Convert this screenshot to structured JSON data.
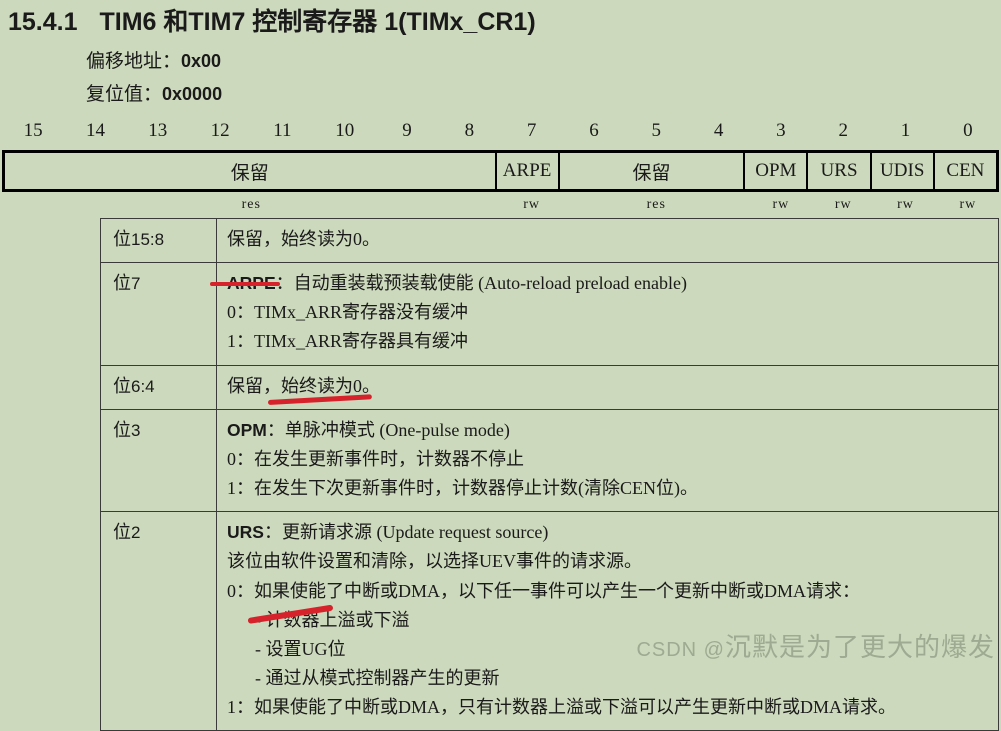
{
  "colors": {
    "page_background": "#ccd9bc",
    "text": "#1a1a1a",
    "annotation_red": "#d6232b",
    "watermark": "#78846e",
    "table_border": "#3a3a3a"
  },
  "title": {
    "section_number": "15.4.1",
    "text": "TIM6 和TIM7 控制寄存器 1(TIMx_CR1)"
  },
  "meta": {
    "offset_label": "偏移地址：",
    "offset_value": "0x00",
    "reset_label": "复位值：",
    "reset_value": "0x0000"
  },
  "register_map": {
    "bit_numbers": [
      "15",
      "14",
      "13",
      "12",
      "11",
      "10",
      "9",
      "8",
      "7",
      "6",
      "5",
      "4",
      "3",
      "2",
      "1",
      "0"
    ],
    "fields": [
      {
        "name": "保留",
        "span": 8,
        "access": "res"
      },
      {
        "name": "ARPE",
        "span": 1,
        "access": "rw"
      },
      {
        "name": "保留",
        "span": 3,
        "access": "res"
      },
      {
        "name": "OPM",
        "span": 1,
        "access": "rw"
      },
      {
        "name": "URS",
        "span": 1,
        "access": "rw"
      },
      {
        "name": "UDIS",
        "span": 1,
        "access": "rw"
      },
      {
        "name": "CEN",
        "span": 1,
        "access": "rw"
      }
    ],
    "access_cells": [
      {
        "label": "res",
        "span": 8
      },
      {
        "label": "rw",
        "span": 1
      },
      {
        "label": "res",
        "span": 3
      },
      {
        "label": "rw",
        "span": 1
      },
      {
        "label": "rw",
        "span": 1
      },
      {
        "label": "rw",
        "span": 1
      },
      {
        "label": "rw",
        "span": 1
      }
    ]
  },
  "bit_descriptions": [
    {
      "bit_label_prefix": "位",
      "bit_label_range": "15:8",
      "lines": [
        {
          "text": "保留，始终读为0。",
          "indent": 0,
          "bold_tag": ""
        }
      ]
    },
    {
      "bit_label_prefix": "位",
      "bit_label_range": "7",
      "lines": [
        {
          "bold_tag": "ARPE",
          "text": "：自动重装载预装载使能 (Auto-reload preload enable)",
          "indent": 0
        },
        {
          "bold_tag": "",
          "text": "0：TIMx_ARR寄存器没有缓冲",
          "indent": 0
        },
        {
          "bold_tag": "",
          "text": "1：TIMx_ARR寄存器具有缓冲",
          "indent": 0
        }
      ]
    },
    {
      "bit_label_prefix": "位",
      "bit_label_range": "6:4",
      "lines": [
        {
          "text": "保留，始终读为0。",
          "indent": 0,
          "bold_tag": ""
        }
      ]
    },
    {
      "bit_label_prefix": "位",
      "bit_label_range": "3",
      "lines": [
        {
          "bold_tag": "OPM",
          "text": "：单脉冲模式 (One-pulse mode)",
          "indent": 0
        },
        {
          "bold_tag": "",
          "text": "0：在发生更新事件时，计数器不停止",
          "indent": 0
        },
        {
          "bold_tag": "",
          "text": "1：在发生下次更新事件时，计数器停止计数(清除CEN位)。",
          "indent": 0
        }
      ]
    },
    {
      "bit_label_prefix": "位",
      "bit_label_range": "2",
      "lines": [
        {
          "bold_tag": "URS",
          "text": "：更新请求源 (Update request source)",
          "indent": 0
        },
        {
          "bold_tag": "",
          "text": "该位由软件设置和清除，以选择UEV事件的请求源。",
          "indent": 0
        },
        {
          "bold_tag": "",
          "text": "0：如果使能了中断或DMA，以下任一事件可以产生一个更新中断或DMA请求：",
          "indent": 0
        },
        {
          "bold_tag": "",
          "text": "- 计数器上溢或下溢",
          "indent": 1
        },
        {
          "bold_tag": "",
          "text": "- 设置UG位",
          "indent": 1
        },
        {
          "bold_tag": "",
          "text": "- 通过从模式控制器产生的更新",
          "indent": 1
        },
        {
          "bold_tag": "",
          "text": "1：如果使能了中断或DMA，只有计数器上溢或下溢可以产生更新中断或DMA请求。",
          "indent": 0
        }
      ]
    }
  ],
  "annotations": [
    {
      "type": "red-underline",
      "target": "ARPE"
    },
    {
      "type": "red-underline",
      "target": "单脉冲模式"
    },
    {
      "type": "red-underline",
      "target": "设置UG位"
    }
  ],
  "watermark": {
    "prefix": "CSDN @",
    "text": "沉默是为了更大的爆发"
  }
}
